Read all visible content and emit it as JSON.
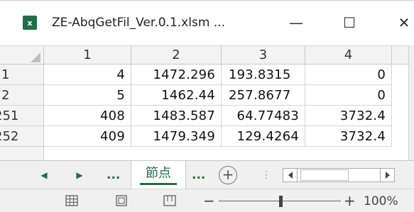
{
  "window": {
    "app_icon_letter": "x",
    "title": "ZE-AbqGetFil_Ver.0.1.xlsm ...",
    "minimize_glyph": "—",
    "maximize_glyph": "☐",
    "close_glyph": "✕"
  },
  "grid": {
    "column_headers": [
      "1",
      "2",
      "3",
      "4"
    ],
    "rows": [
      {
        "header": "1",
        "cells": [
          "4",
          "1472.296",
          "193.8315",
          "0"
        ]
      },
      {
        "header": "2",
        "cells": [
          "5",
          "1462.44",
          "257.8677",
          "0"
        ]
      },
      {
        "header": "251",
        "cells": [
          "408",
          "1483.587",
          "64.77483",
          "3732.4"
        ]
      },
      {
        "header": "252",
        "cells": [
          "409",
          "1479.349",
          "129.4264",
          "3732.4"
        ]
      }
    ]
  },
  "sheet_tabs": {
    "prev_glyph": "◀",
    "next_glyph": "▶",
    "left_ellipsis": "...",
    "active_tab": "節点",
    "right_ellipsis": "...",
    "add_sheet_glyph": "+",
    "separator_glyph": "⋮"
  },
  "status_bar": {
    "zoom_minus": "−",
    "zoom_plus": "+",
    "zoom_level": "100%",
    "zoom_fraction": 0.5
  },
  "colors": {
    "accent": "#1e7145",
    "header_bg": "#f3f3f3",
    "gridline": "#d5d5d5"
  }
}
